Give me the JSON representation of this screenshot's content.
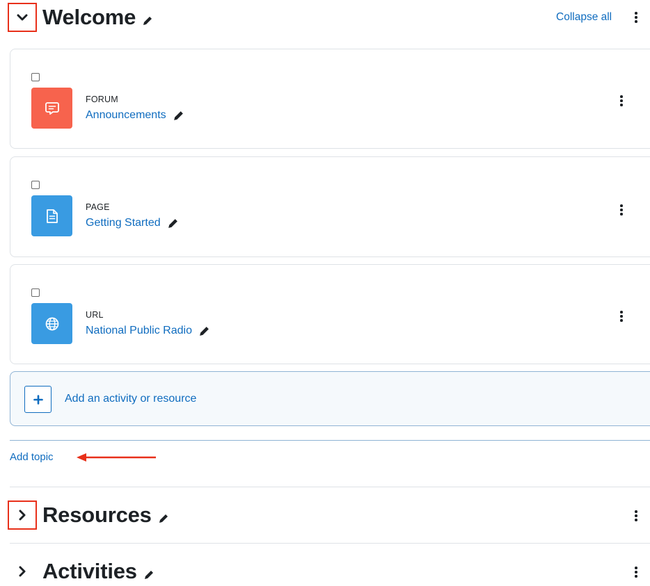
{
  "sections": {
    "welcome": {
      "title": "Welcome"
    },
    "resources": {
      "title": "Resources"
    },
    "activities": {
      "title": "Activities"
    }
  },
  "header": {
    "collapse_all": "Collapse all"
  },
  "modules": [
    {
      "type": "FORUM",
      "name": "Announcements",
      "icon": "forum-icon",
      "color": "#f7634d"
    },
    {
      "type": "PAGE",
      "name": "Getting Started",
      "icon": "page-icon",
      "color": "#399be2"
    },
    {
      "type": "URL",
      "name": "National Public Radio",
      "icon": "globe-icon",
      "color": "#399be2"
    }
  ],
  "add_activity": {
    "label": "Add an activity or resource"
  },
  "add_topic": {
    "label": "Add topic"
  },
  "colors": {
    "link": "#0f6cbf",
    "highlight": "#e8301a",
    "forum": "#f7634d",
    "page": "#399be2"
  }
}
